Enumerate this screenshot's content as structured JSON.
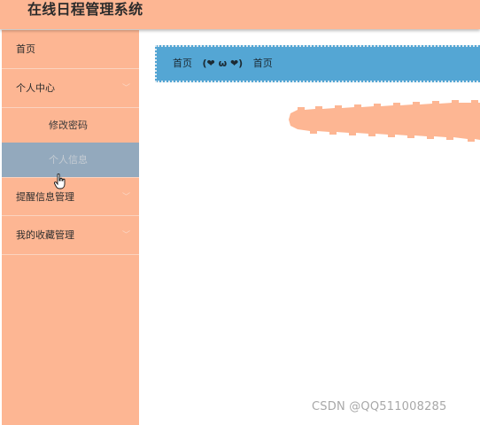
{
  "app": {
    "title": "在线日程管理系统"
  },
  "sidebar": {
    "items": [
      {
        "label": "首页"
      },
      {
        "label": "个人中心",
        "children": [
          {
            "label": "修改密码"
          },
          {
            "label": "个人信息",
            "active": true
          }
        ]
      },
      {
        "label": "提醒信息管理"
      },
      {
        "label": "我的收藏管理"
      }
    ]
  },
  "breadcrumb": {
    "home": "首页",
    "separator": "(❤ ω ❤)",
    "current": "首页"
  },
  "watermark": "CSDN @QQ511008285",
  "colors": {
    "header": "#fdb693",
    "sidebar": "#fdb693",
    "active_item": "#93a9bd",
    "breadcrumb_bg": "#54a6d4",
    "decor": "#fdb693"
  }
}
